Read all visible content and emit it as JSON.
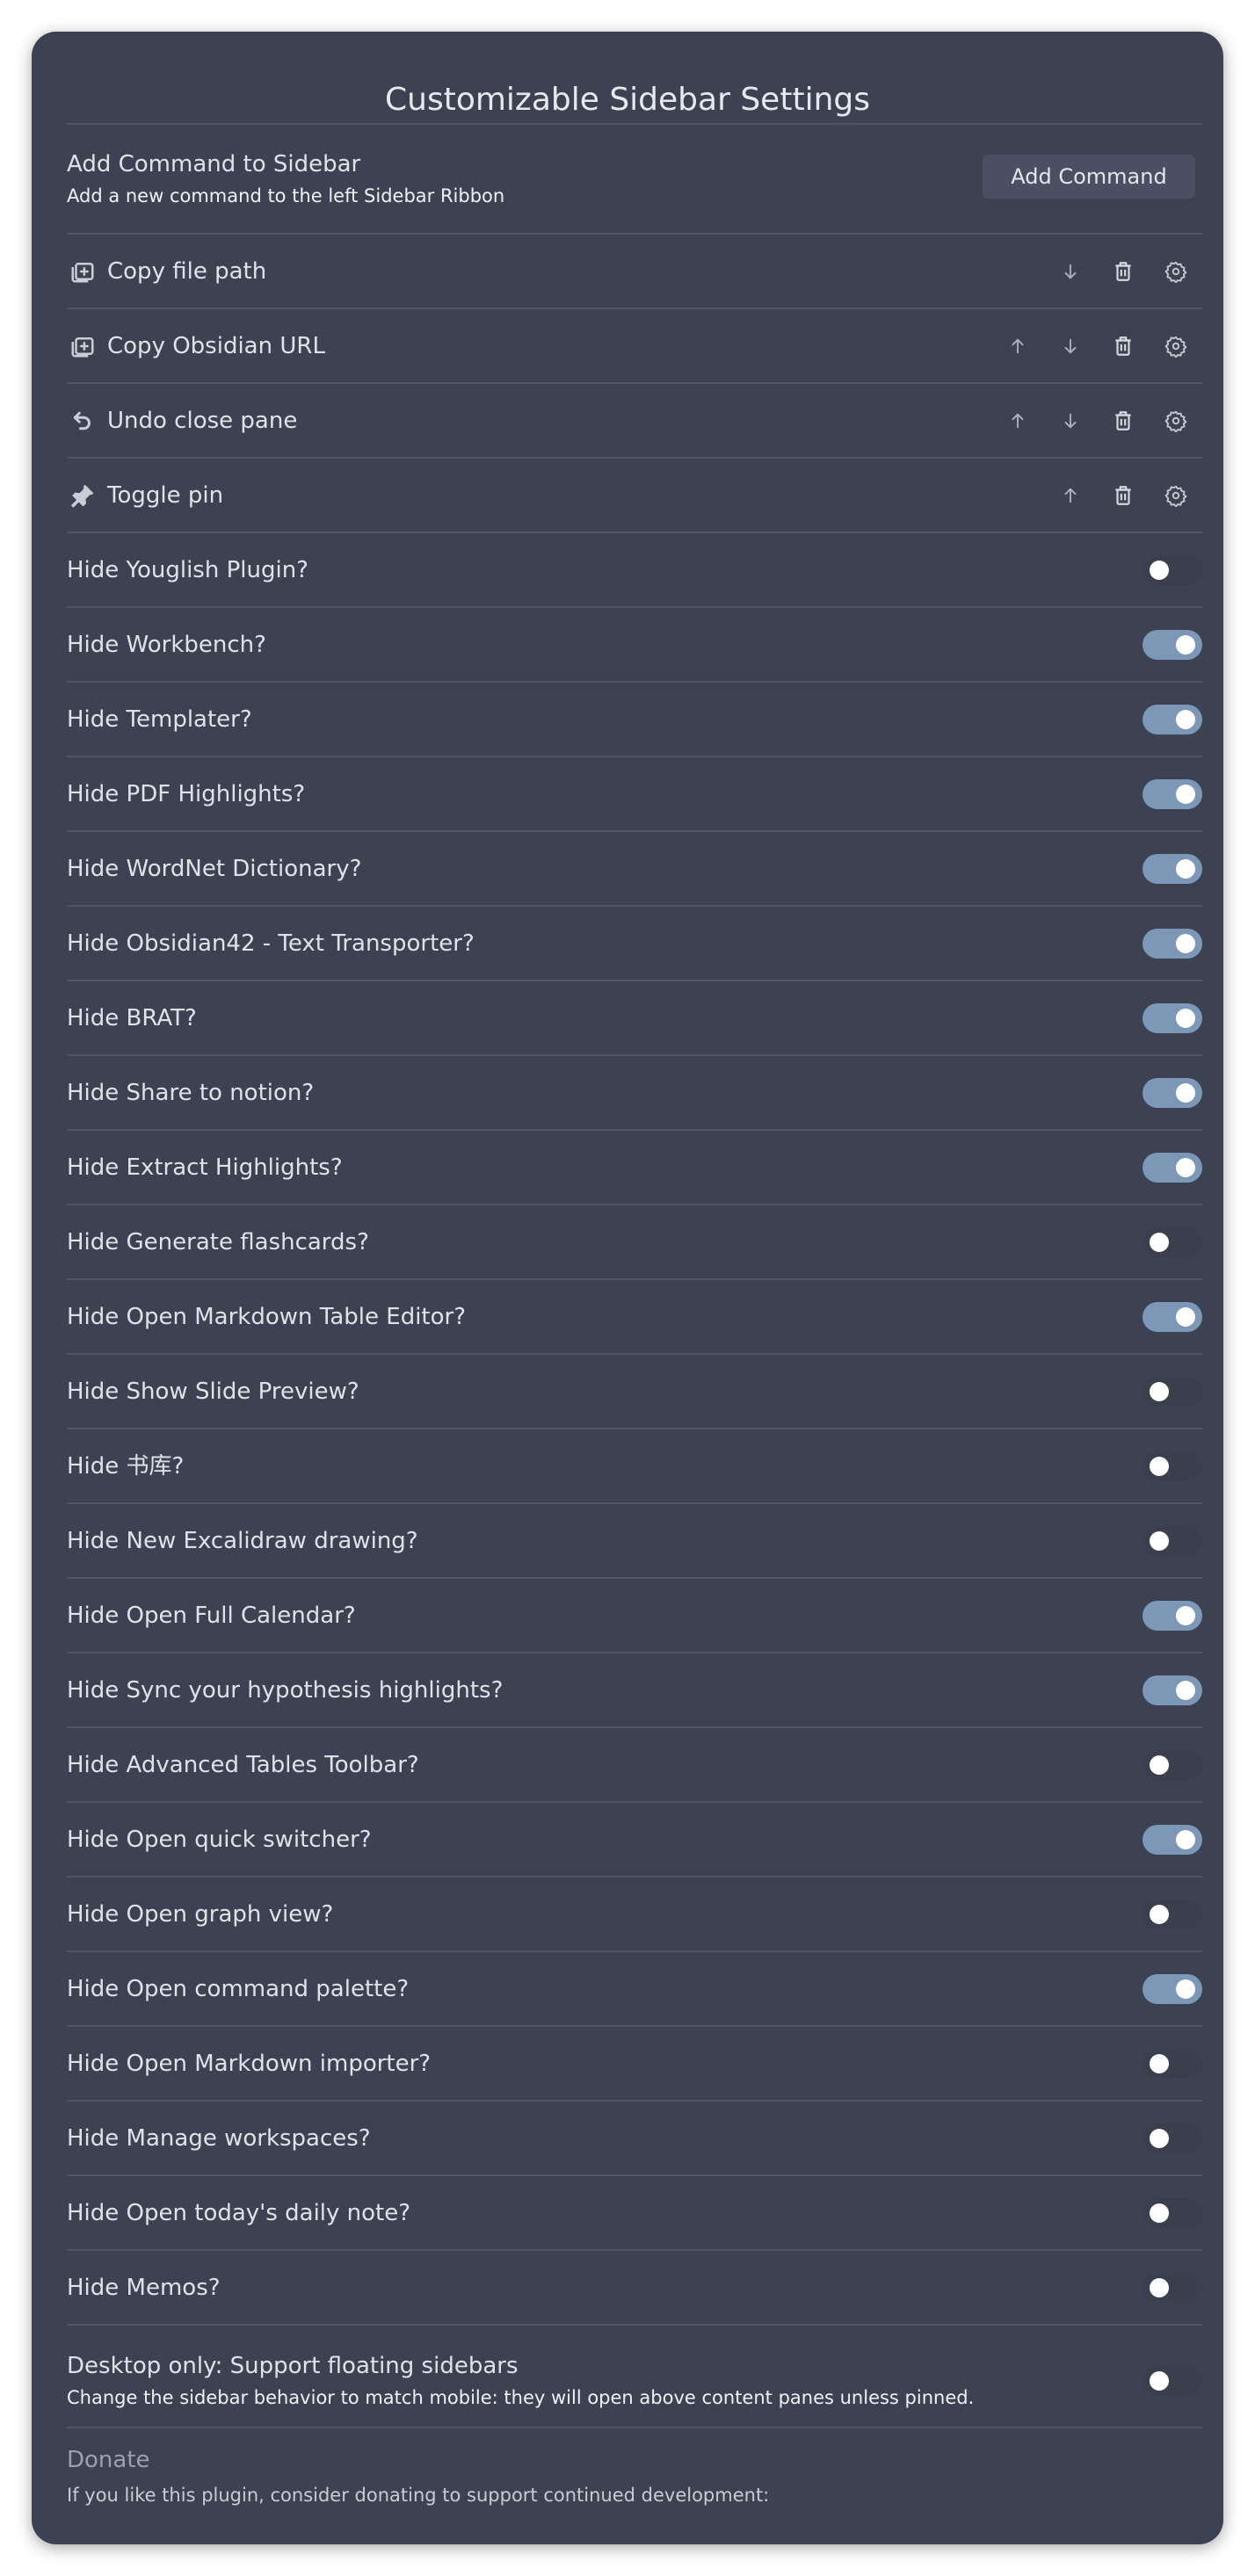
{
  "title": "Customizable Sidebar Settings",
  "add_command": {
    "name": "Add Command to Sidebar",
    "description": "Add a new command to the left Sidebar Ribbon",
    "button_label": "Add Command"
  },
  "commands": [
    {
      "label": "Copy file path",
      "icon": "file-plus-icon",
      "up": false,
      "down": true
    },
    {
      "label": "Copy Obsidian URL",
      "icon": "file-plus-icon",
      "up": true,
      "down": true
    },
    {
      "label": "Undo close pane",
      "icon": "undo-icon",
      "up": true,
      "down": true
    },
    {
      "label": "Toggle pin",
      "icon": "pin-icon",
      "up": true,
      "down": false
    }
  ],
  "toggles": [
    {
      "label": "Hide Youglish Plugin?",
      "on": false
    },
    {
      "label": "Hide Workbench?",
      "on": true
    },
    {
      "label": "Hide Templater?",
      "on": true
    },
    {
      "label": "Hide PDF Highlights?",
      "on": true
    },
    {
      "label": "Hide WordNet Dictionary?",
      "on": true
    },
    {
      "label": "Hide Obsidian42 - Text Transporter?",
      "on": true
    },
    {
      "label": "Hide BRAT?",
      "on": true
    },
    {
      "label": "Hide Share to notion?",
      "on": true
    },
    {
      "label": "Hide Extract Highlights?",
      "on": true
    },
    {
      "label": "Hide Generate flashcards?",
      "on": false
    },
    {
      "label": "Hide Open Markdown Table Editor?",
      "on": true
    },
    {
      "label": "Hide Show Slide Preview?",
      "on": false
    },
    {
      "label": "Hide 书库?",
      "on": false
    },
    {
      "label": "Hide New Excalidraw drawing?",
      "on": false
    },
    {
      "label": "Hide Open Full Calendar?",
      "on": true
    },
    {
      "label": "Hide Sync your hypothesis highlights?",
      "on": true
    },
    {
      "label": "Hide Advanced Tables Toolbar?",
      "on": false
    },
    {
      "label": "Hide Open quick switcher?",
      "on": true
    },
    {
      "label": "Hide Open graph view?",
      "on": false
    },
    {
      "label": "Hide Open command palette?",
      "on": true
    },
    {
      "label": "Hide Open Markdown importer?",
      "on": false
    },
    {
      "label": "Hide Manage workspaces?",
      "on": false
    },
    {
      "label": "Hide Open today's daily note?",
      "on": false
    },
    {
      "label": "Hide Memos?",
      "on": false
    }
  ],
  "floating": {
    "name": "Desktop only: Support floating sidebars",
    "description": "Change the sidebar behavior to match mobile: they will open above content panes unless pinned.",
    "on": false
  },
  "donate": {
    "title": "Donate",
    "description": "If you like this plugin, consider donating to support continued development:"
  },
  "colors": {
    "background": "#3d4252",
    "toggle_on": "#7d97b7",
    "toggle_off": "#3a3f4d"
  }
}
